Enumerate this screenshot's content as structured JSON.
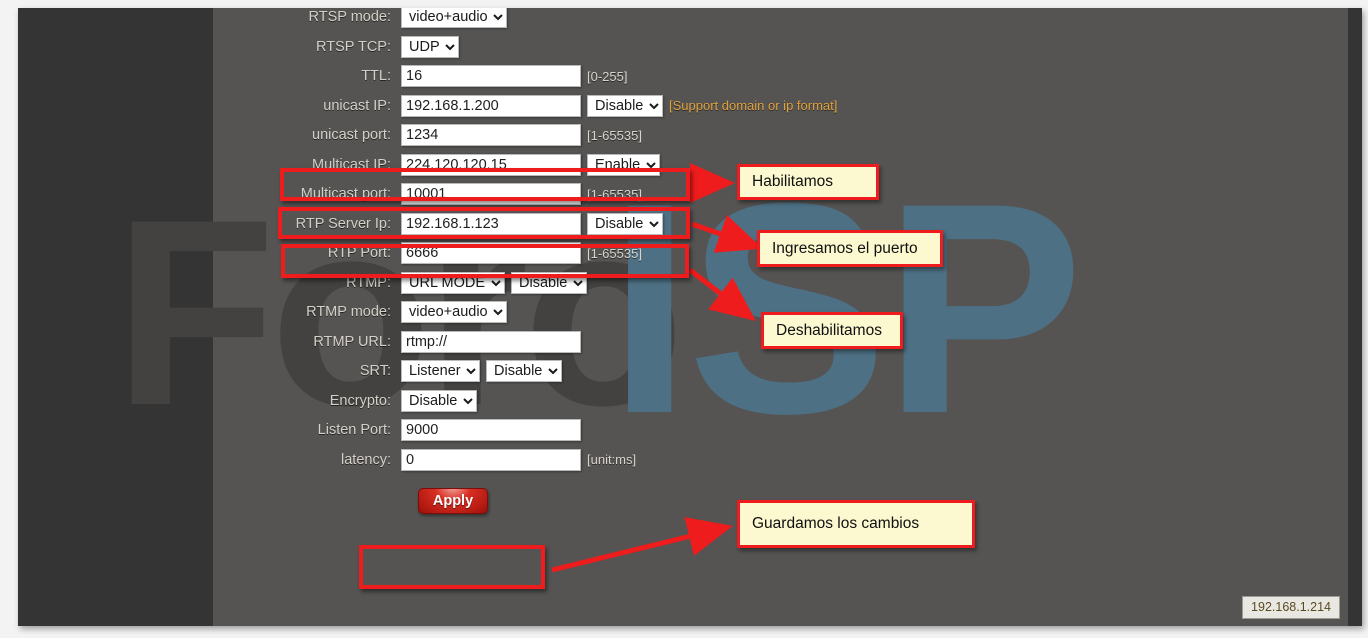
{
  "page": {
    "watermark_primary": "Foro",
    "watermark_secondary": "ISP",
    "accent_red": "#ee1c1c",
    "callout_bg": "#fcf8cf",
    "page_bg": "#555453",
    "rail_bg": "#343434"
  },
  "form": {
    "rows": [
      {
        "label": "RTSP mode:",
        "value": "video+audio",
        "control": "select",
        "hint": ""
      },
      {
        "label": "RTSP TCP:",
        "value": "UDP",
        "control": "select",
        "hint": ""
      },
      {
        "label": "TTL:",
        "value": "16",
        "control": "text",
        "hint": "[0-255]"
      },
      {
        "label": "unicast IP:",
        "value": "192.168.1.200",
        "control": "text",
        "select2": "Disable",
        "hint": "[Support domain or ip format]"
      },
      {
        "label": "unicast port:",
        "value": "1234",
        "control": "text",
        "hint": "[1-65535]"
      },
      {
        "label": "Multicast IP:",
        "value": "224.120.120.15",
        "control": "text",
        "select2": "Enable",
        "hint": ""
      },
      {
        "label": "Multicast port:",
        "value": "10001",
        "control": "text",
        "hint": "[1-65535]"
      },
      {
        "label": "RTP Server Ip:",
        "value": "192.168.1.123",
        "control": "text",
        "select2": "Disable",
        "hint": ""
      },
      {
        "label": "RTP Port:",
        "value": "6666",
        "control": "text",
        "hint": "[1-65535]"
      },
      {
        "label": "RTMP:",
        "value": "URL MODE",
        "control": "select",
        "select2": "Disable",
        "hint": ""
      },
      {
        "label": "RTMP mode:",
        "value": "video+audio",
        "control": "select",
        "hint": ""
      },
      {
        "label": "RTMP URL:",
        "value": "rtmp://",
        "control": "text",
        "hint": ""
      },
      {
        "label": "SRT:",
        "value": "Listener",
        "control": "select",
        "select2": "Disable",
        "hint": ""
      },
      {
        "label": "Encrypto:",
        "value": "Disable",
        "control": "select",
        "hint": ""
      },
      {
        "label": "Listen Port:",
        "value": "9000",
        "control": "text",
        "hint": ""
      },
      {
        "label": "latency:",
        "value": "0",
        "control": "text",
        "hint": "[unit:ms]"
      }
    ],
    "apply_label": "Apply"
  },
  "annotations": {
    "callouts": [
      {
        "text": "Habilitamos"
      },
      {
        "text": "Ingresamos el puerto"
      },
      {
        "text": "Deshabilitamos"
      },
      {
        "text": "Guardamos los cambios"
      }
    ]
  },
  "status": {
    "ip_address": "192.168.1.214"
  }
}
